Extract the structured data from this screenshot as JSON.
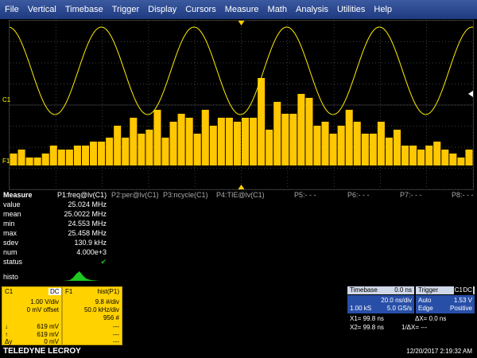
{
  "menu": [
    "File",
    "Vertical",
    "Timebase",
    "Trigger",
    "Display",
    "Cursors",
    "Measure",
    "Math",
    "Analysis",
    "Utilities",
    "Help"
  ],
  "trace_labels": {
    "c1": "C1",
    "f1": "F1"
  },
  "colors": {
    "trace": "#ffee00",
    "bar": "#ffc800",
    "grid": "#555555",
    "accent": "#3050a0"
  },
  "histogram_bars": [
    3,
    4,
    2,
    2,
    3,
    5,
    4,
    4,
    5,
    5,
    6,
    6,
    7,
    10,
    7,
    12,
    8,
    9,
    14,
    7,
    11,
    13,
    12,
    8,
    14,
    10,
    12,
    12,
    11,
    12,
    12,
    22,
    9,
    16,
    13,
    13,
    18,
    17,
    10,
    11,
    8,
    10,
    14,
    11,
    8,
    8,
    11,
    7,
    9,
    5,
    5,
    4,
    5,
    6,
    4,
    3,
    2,
    4
  ],
  "measure": {
    "title": "Measure",
    "params": [
      "P1:freq@lv(C1)",
      "P2:per@lv(C1)",
      "P3:ncycle(C1)",
      "P4:TIE@lv(C1)",
      "P5:- - -",
      "P6:- - -",
      "P7:- - -",
      "P8:- - -"
    ],
    "rows": [
      {
        "label": "value",
        "v": "25.024 MHz"
      },
      {
        "label": "mean",
        "v": "25.0022 MHz"
      },
      {
        "label": "min",
        "v": "24.553 MHz"
      },
      {
        "label": "max",
        "v": "25.458 MHz"
      },
      {
        "label": "sdev",
        "v": "130.9 kHz"
      },
      {
        "label": "num",
        "v": "4.000e+3"
      },
      {
        "label": "status",
        "v": "✔"
      }
    ],
    "histo": "histo"
  },
  "c1_box": {
    "title": "C1",
    "tag": "DC",
    "vdiv": "1.00 V/div",
    "offset": "0 mV offset",
    "l1": "619 mV",
    "l2": "619 mV",
    "l3": "0 mV",
    "s1": "↓",
    "s2": "↑",
    "s3": "Δy"
  },
  "f1_box": {
    "title": "F1",
    "func": "hist(P1)",
    "l1": "9.8 #/div",
    "l2": "50.0 kHz/div",
    "l3": "956 #",
    "l4": "---",
    "l5": "---",
    "l6": "---"
  },
  "timebase": {
    "title": "Timebase",
    "delay": "0.0 ns",
    "tdiv": "20.0 ns/div",
    "samples": "1.00 kS",
    "rate": "5.0 GS/s"
  },
  "trigger": {
    "title": "Trigger",
    "ch": "C1",
    "coupling": "DC",
    "mode": "Auto",
    "level": "1.53 V",
    "type": "Edge",
    "slope": "Positive"
  },
  "cursors": {
    "x1": "X1= 99.8 ns",
    "dx": "ΔX= 0.0 ns",
    "x2": "X2= 99.8 ns",
    "idx": "1/ΔX= ---"
  },
  "footer": {
    "brand": "TELEDYNE LECROY",
    "date": "12/20/2017 2:19:32 AM"
  }
}
